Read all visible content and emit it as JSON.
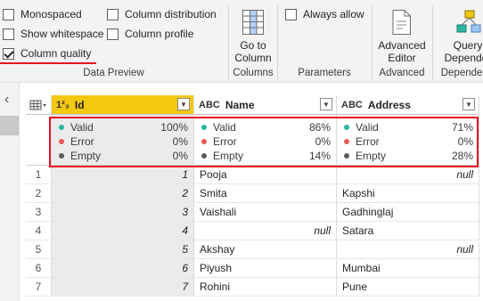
{
  "ribbon": {
    "data_preview": {
      "checkboxes": [
        {
          "label": "Monospaced",
          "checked": false
        },
        {
          "label": "Column distribution",
          "checked": false
        },
        {
          "label": "Show whitespace",
          "checked": false
        },
        {
          "label": "Column profile",
          "checked": false
        },
        {
          "label": "Column quality",
          "checked": true
        }
      ],
      "group_label": "Data Preview"
    },
    "columns": {
      "button_label": "Go to\nColumn",
      "button_line1": "Go to",
      "button_line2": "Column",
      "group_label": "Columns"
    },
    "parameters": {
      "checkbox_label": "Always allow",
      "checked": false,
      "group_label": "Parameters"
    },
    "advanced": {
      "button_line1": "Advanced",
      "button_line2": "Editor",
      "group_label": "Advanced"
    },
    "dependencies": {
      "button_line1": "Query",
      "button_line2": "Depender",
      "group_label": "Depender"
    }
  },
  "grid": {
    "columns": [
      {
        "type_label": "1²₃",
        "name": "Id",
        "selected": true,
        "quality": {
          "valid_label": "Valid",
          "valid": "100%",
          "error_label": "Error",
          "error": "0%",
          "empty_label": "Empty",
          "empty": "0%"
        }
      },
      {
        "type_label": "ABC",
        "name": "Name",
        "selected": false,
        "quality": {
          "valid_label": "Valid",
          "valid": "86%",
          "error_label": "Error",
          "error": "0%",
          "empty_label": "Empty",
          "empty": "14%"
        }
      },
      {
        "type_label": "ABC",
        "name": "Address",
        "selected": false,
        "quality": {
          "valid_label": "Valid",
          "valid": "71%",
          "error_label": "Error",
          "error": "0%",
          "empty_label": "Empty",
          "empty": "28%"
        }
      }
    ],
    "rows": [
      {
        "num": "1",
        "id": "1",
        "name": "Pooja",
        "address": "null"
      },
      {
        "num": "2",
        "id": "2",
        "name": "Smita",
        "address": "Kapshi"
      },
      {
        "num": "3",
        "id": "3",
        "name": "Vaishali",
        "address": "Gadhinglaj"
      },
      {
        "num": "4",
        "id": "4",
        "name": "null",
        "address": "Satara"
      },
      {
        "num": "5",
        "id": "5",
        "name": "Akshay",
        "address": "null"
      },
      {
        "num": "6",
        "id": "6",
        "name": "Piyush",
        "address": "Mumbai"
      },
      {
        "num": "7",
        "id": "7",
        "name": "Rohini",
        "address": "Pune"
      }
    ]
  },
  "colors": {
    "valid_dot": "#2bb5a0",
    "error_dot": "#e8585a",
    "empty_dot": "#5c5c5c",
    "highlight": "#e81123",
    "selected_header": "#f2c811"
  },
  "left_panel": {
    "collapse_icon": "chevron-left-icon"
  }
}
